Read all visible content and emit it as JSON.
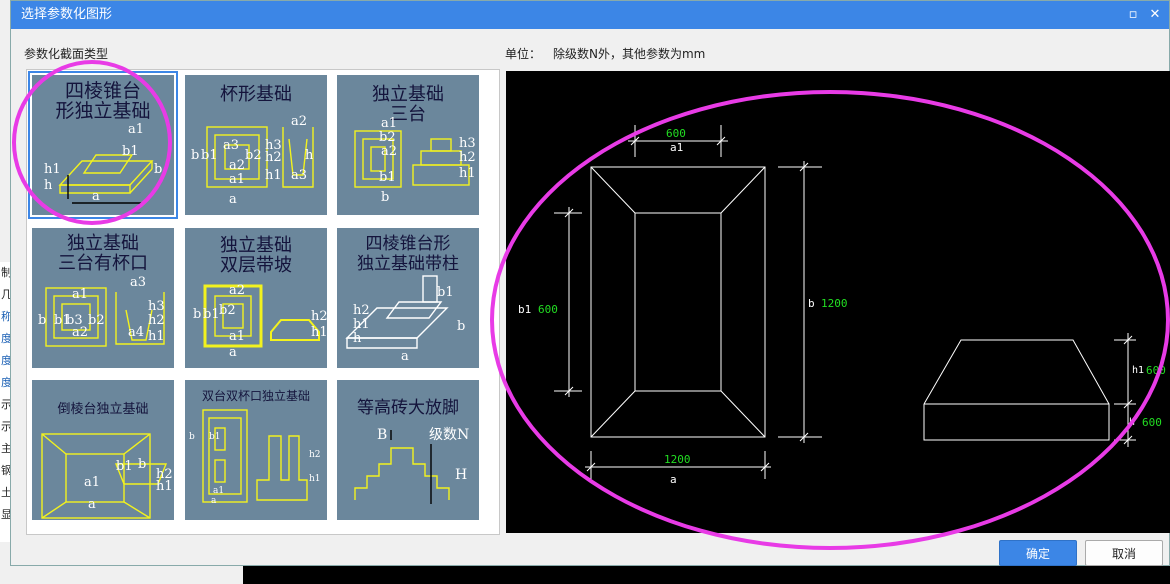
{
  "dialog": {
    "title": "选择参数化图形",
    "section_label": "参数化截面类型",
    "unit_label": "单位：",
    "unit_text": "除级数N外，其他参数为mm",
    "ok_label": "确定",
    "cancel_label": "取消"
  },
  "side_items": [
    "制表",
    "几",
    "称",
    "度",
    "度",
    "度",
    "示",
    "示",
    "主",
    "钢",
    "土",
    "显"
  ],
  "tiles": [
    {
      "title_l1": "四棱锥台",
      "title_l2": "形独立基础",
      "labels": [
        "a1",
        "b1",
        "h1",
        "h",
        "b",
        "a"
      ]
    },
    {
      "title_l1": "杯形基础",
      "title_l2": "",
      "labels": [
        "b",
        "b1",
        "a3",
        "b2",
        "h3",
        "h2",
        "h",
        "h1",
        "a2",
        "a1",
        "a",
        "a3",
        "a2"
      ]
    },
    {
      "title_l1": "独立基础",
      "title_l2": "三台",
      "labels": [
        "a1",
        "a2",
        "b2",
        "b1",
        "h3",
        "h2",
        "h1",
        "b"
      ]
    },
    {
      "title_l1": "独立基础",
      "title_l2": "三台有杯口",
      "labels": [
        "a1",
        "a3",
        "b",
        "b1",
        "b2",
        "b3",
        "a2",
        "h3",
        "h2",
        "h1",
        "a4"
      ]
    },
    {
      "title_l1": "独立基础",
      "title_l2": "双层带坡",
      "labels": [
        "a2",
        "b",
        "b1",
        "b2",
        "a1",
        "a",
        "h2",
        "h1"
      ]
    },
    {
      "title_l1": "四棱锥台形",
      "title_l2": "独立基础带柱",
      "labels": [
        "h2",
        "h1",
        "h",
        "a",
        "b1",
        "b"
      ]
    },
    {
      "title_l1": "倒棱台独立基础",
      "title_l2": "",
      "labels": [
        "b1",
        "a1",
        "a",
        "b",
        "h2",
        "h1"
      ]
    },
    {
      "title_l1": "双台双杯口独立基础",
      "title_l2": "",
      "labels": [
        "b",
        "b1",
        "a1",
        "a",
        "h2",
        "h1"
      ]
    },
    {
      "title_l1": "等高砖大放脚",
      "title_l2": "",
      "labels": [
        "B",
        "级数N",
        "H"
      ]
    }
  ],
  "preview": {
    "a1_value": "600",
    "a1_label": "a1",
    "b1_label": "b1",
    "b1_value": "600",
    "b_label": "b",
    "b_value": "1200",
    "a_value": "1200",
    "a_label": "a",
    "h1_label": "h1",
    "h1_value": "600",
    "h_label": "h",
    "h_value": "600"
  },
  "colors": {
    "title_bar": "#3c86e6",
    "accent": "#3c86e6",
    "highlight_ring": "#e83be6",
    "tile_bg": "#6b879c",
    "drawing_line": "#ffffff",
    "dim_value": "#22dd22"
  }
}
